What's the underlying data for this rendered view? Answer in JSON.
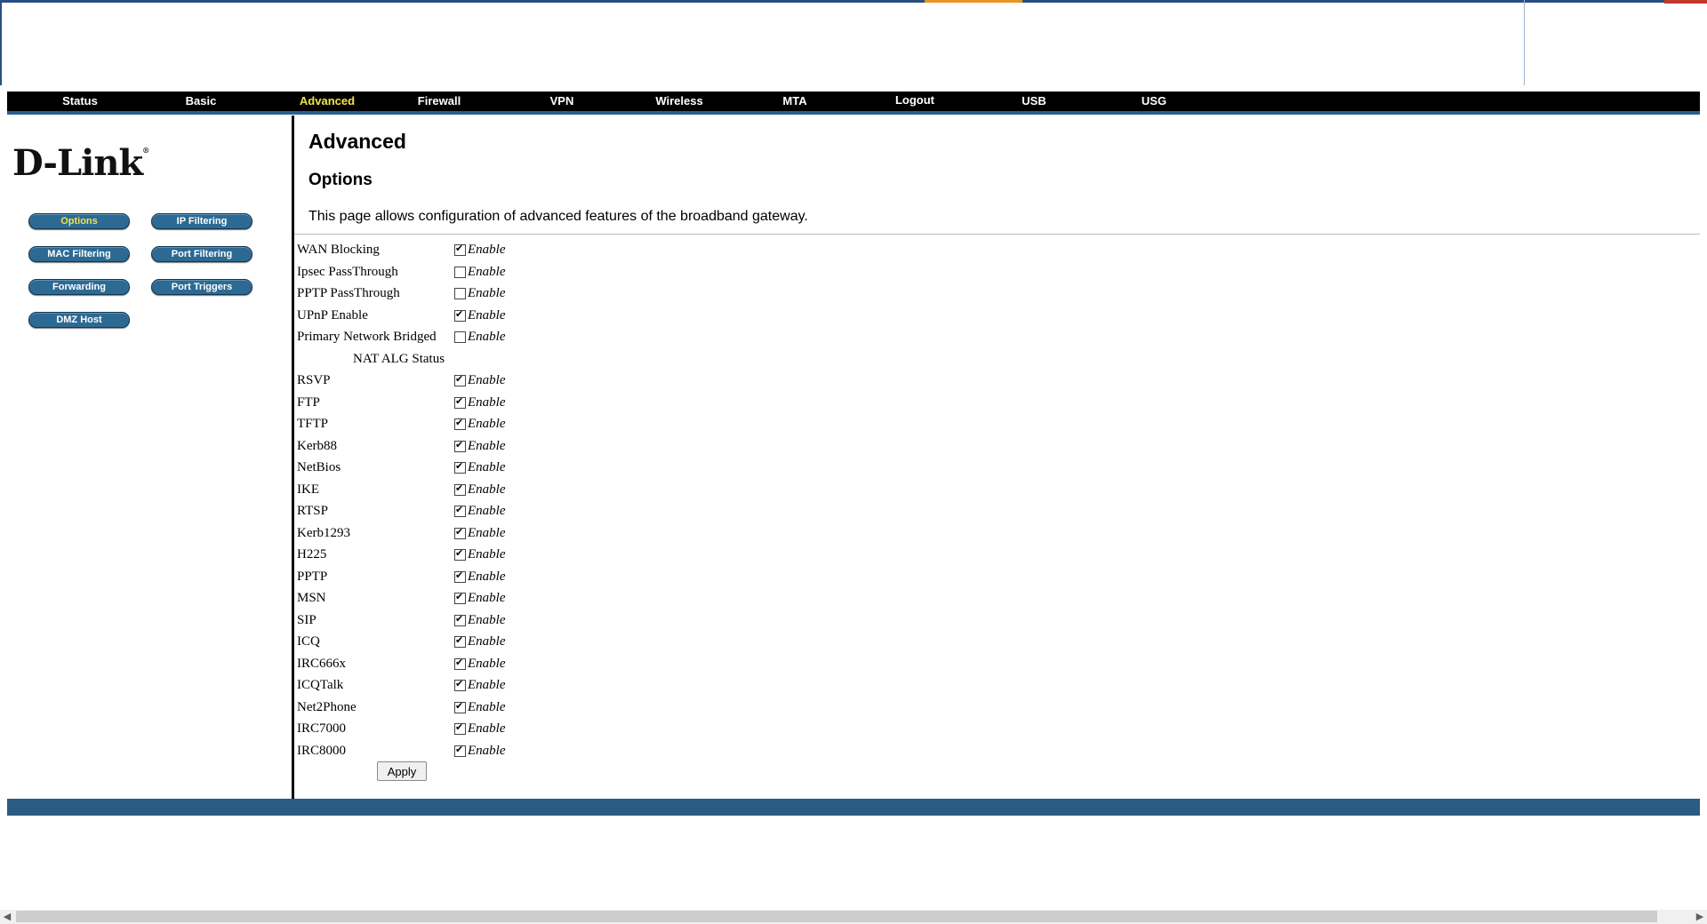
{
  "nav": {
    "items": [
      {
        "label": "Status",
        "active": false
      },
      {
        "label": "Basic",
        "active": false
      },
      {
        "label": "Advanced",
        "active": true
      },
      {
        "label": "Firewall",
        "active": false
      },
      {
        "label": "VPN",
        "active": false
      },
      {
        "label": "Wireless",
        "active": false
      },
      {
        "label": "MTA",
        "active": false
      },
      {
        "label": "Logout",
        "active": false
      },
      {
        "label": "USB",
        "active": false
      },
      {
        "label": "USG",
        "active": false
      }
    ]
  },
  "sidebar": {
    "logo_text": "D-Link",
    "logo_mark": "®",
    "buttons": [
      {
        "label": "Options",
        "active": true
      },
      {
        "label": "IP Filtering",
        "active": false
      },
      {
        "label": "MAC Filtering",
        "active": false
      },
      {
        "label": "Port Filtering",
        "active": false
      },
      {
        "label": "Forwarding",
        "active": false
      },
      {
        "label": "Port Triggers",
        "active": false
      },
      {
        "label": "DMZ Host",
        "active": false
      }
    ]
  },
  "main": {
    "title": "Advanced",
    "section_title": "Options",
    "description": "This page allows configuration of advanced features of the broadband gateway.",
    "enable_label": "Enable",
    "nat_alg_heading": "NAT ALG Status",
    "options": [
      {
        "label": "WAN Blocking",
        "checked": true
      },
      {
        "label": "Ipsec PassThrough",
        "checked": false
      },
      {
        "label": "PPTP PassThrough",
        "checked": false
      },
      {
        "label": "UPnP Enable",
        "checked": true
      },
      {
        "label": "Primary Network Bridged",
        "checked": false
      }
    ],
    "nat_alg": [
      {
        "label": "RSVP",
        "checked": true
      },
      {
        "label": "FTP",
        "checked": true
      },
      {
        "label": "TFTP",
        "checked": true
      },
      {
        "label": "Kerb88",
        "checked": true
      },
      {
        "label": "NetBios",
        "checked": true
      },
      {
        "label": "IKE",
        "checked": true
      },
      {
        "label": "RTSP",
        "checked": true
      },
      {
        "label": "Kerb1293",
        "checked": true
      },
      {
        "label": "H225",
        "checked": true
      },
      {
        "label": "PPTP",
        "checked": true
      },
      {
        "label": "MSN",
        "checked": true
      },
      {
        "label": "SIP",
        "checked": true
      },
      {
        "label": "ICQ",
        "checked": true
      },
      {
        "label": "IRC666x",
        "checked": true
      },
      {
        "label": "ICQTalk",
        "checked": true
      },
      {
        "label": "Net2Phone",
        "checked": true
      },
      {
        "label": "IRC7000",
        "checked": true
      },
      {
        "label": "IRC8000",
        "checked": true
      }
    ],
    "apply_label": "Apply"
  },
  "colors": {
    "navbar_bg": "#000000",
    "accent_blue": "#2a5b82",
    "active_text": "#f3e24a"
  }
}
